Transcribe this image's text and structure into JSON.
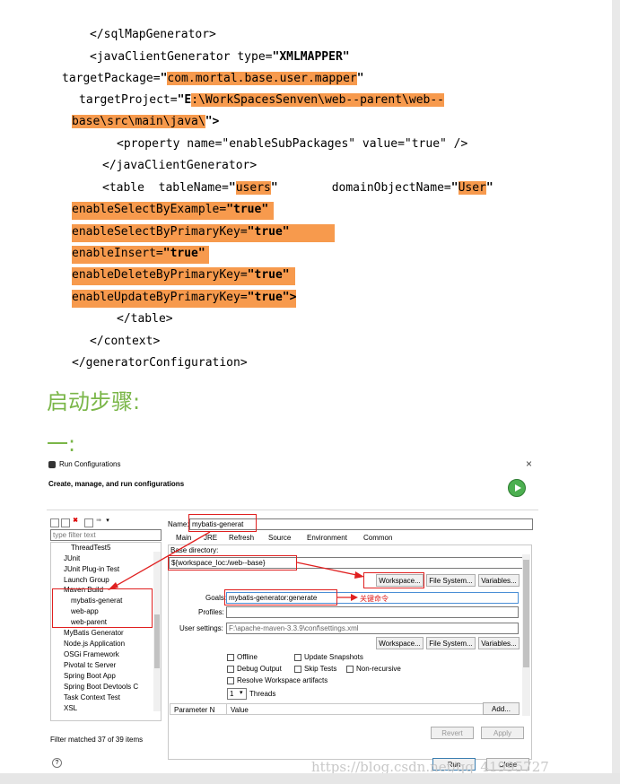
{
  "code": {
    "l1": "</sqlMapGenerator>",
    "l2a": "<javaClientGenerator type=",
    "l2b": "\"XMLMAPPER\"",
    "l3a": "targetPackage=",
    "l3b": "\"",
    "l3c": "com.mortal.base.user.mapper",
    "l3d": "\"",
    "l4a": "targetProject=",
    "l4b": "\"E",
    "l4c": ":\\WorkSpacesSenven\\web--parent\\web--",
    "l5a": "base\\src\\main\\java\\",
    "l5b": "\">",
    "l6": "<property name=\"enableSubPackages\" value=\"true\" />",
    "l7": "</javaClientGenerator>",
    "l8a": "<table  tableName=",
    "l8b": "\"",
    "l8c": "users",
    "l8d": "\"",
    "l8e": "domainObjectName=",
    "l8f": "\"",
    "l8g": "User",
    "l8h": "\"",
    "l9a": "enableSelectByExample=",
    "l9b": "\"true\"",
    "l10a": "enableSelectByPrimaryKey=",
    "l10b": "\"true\"",
    "l11a": "enableInsert=",
    "l11b": "\"true\"",
    "l12a": "enableDeleteByPrimaryKey=",
    "l12b": "\"true\"",
    "l13a": "enableUpdateByPrimaryKey=",
    "l13b": "\"true\">",
    "l14": "</table>",
    "l15": "</context>",
    "l16": "</generatorConfiguration>"
  },
  "heading1": "启动步骤:",
  "heading2": "一:",
  "dialog": {
    "title": "Run Configurations",
    "close": "×",
    "subtitle": "Create, manage, and run configurations",
    "filter_placeholder": "type filter text",
    "tree": [
      "ThreadTest5",
      "JUnit",
      "JUnit Plug-in Test",
      "Launch Group",
      "Maven Build",
      "mybatis-generat",
      "web-app",
      "web-parent",
      "MyBatis Generator",
      "Node.js Application",
      "OSGi Framework",
      "Pivotal tc Server",
      "Spring Boot App",
      "Spring Boot Devtools C",
      "Task Context Test",
      "XSL"
    ],
    "filter_status": "Filter matched 37 of 39 items",
    "name_label": "Name:",
    "name_value": "mybatis-generat",
    "tabs": [
      "Main",
      "JRE",
      "Refresh",
      "Source",
      "Environment",
      "Common"
    ],
    "base_dir_label": "Base directory:",
    "base_dir_value": "${workspace_loc:/web--base}",
    "workspace_btn": "Workspace...",
    "filesystem_btn": "File System...",
    "variables_btn": "Variables...",
    "goals_label": "Goals:",
    "goals_value": "mybatis-generator:generate",
    "annotation": "关键命令",
    "profiles_label": "Profiles:",
    "user_settings_label": "User settings:",
    "user_settings_value": "F:\\apache-maven-3.3.9\\conf\\settings.xml",
    "offline": "Offline",
    "update_snapshots": "Update Snapshots",
    "debug_output": "Debug Output",
    "skip_tests": "Skip Tests",
    "non_recursive": "Non-recursive",
    "resolve_workspace": "Resolve Workspace artifacts",
    "threads_value": "1",
    "threads_label": "Threads",
    "param_col": "Parameter N",
    "value_col": "Value",
    "add_btn": "Add...",
    "revert_btn": "Revert",
    "apply_btn": "Apply",
    "help": "?",
    "run_btn": "Run",
    "close_btn": "Close"
  },
  "watermark": "https://blog.csdn.net/qq_41995727",
  "colors": {
    "highlight": "#f79a4d",
    "heading": "#7ab648",
    "annotation": "#e02020"
  }
}
